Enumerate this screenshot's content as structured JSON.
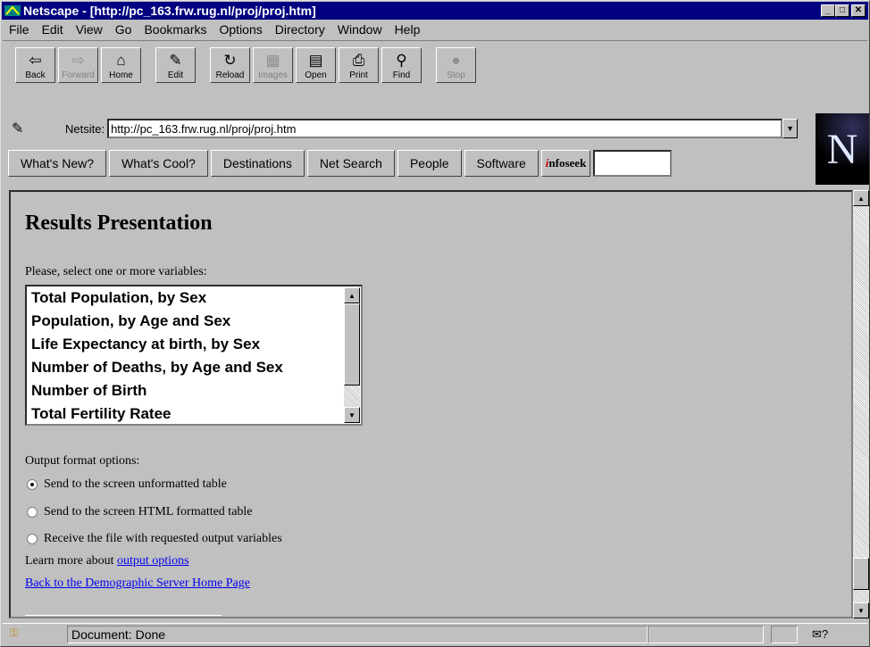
{
  "window": {
    "title": "Netscape - [http://pc_163.frw.rug.nl/proj/proj.htm]"
  },
  "menu": [
    "File",
    "Edit",
    "View",
    "Go",
    "Bookmarks",
    "Options",
    "Directory",
    "Window",
    "Help"
  ],
  "toolbar": {
    "back": "Back",
    "forward": "Forward",
    "home": "Home",
    "edit": "Edit",
    "reload": "Reload",
    "images": "Images",
    "open": "Open",
    "print": "Print",
    "find": "Find",
    "stop": "Stop"
  },
  "location": {
    "label": "Netsite:",
    "url": "http://pc_163.frw.rug.nl/proj/proj.htm"
  },
  "directory": [
    "What's New?",
    "What's Cool?",
    "Destinations",
    "Net Search",
    "People",
    "Software"
  ],
  "infoseek": {
    "i": "i",
    "rest": "nfoseek"
  },
  "logo": "N",
  "page": {
    "heading": "Results Presentation",
    "prompt": "Please, select one or more variables:",
    "variables": [
      "Total Population, by Sex",
      "Population, by Age and Sex",
      "Life Expectancy at birth, by Sex",
      "Number of Deaths, by Age and Sex",
      "Number of Birth",
      "Total Fertility Ratee"
    ],
    "output_label": "Output format options:",
    "options": [
      "Send to the screen unformatted table",
      "Send to the screen HTML formatted table",
      "Receive the file with requested output variables"
    ],
    "learn_text": "Learn more about ",
    "learn_link": "output options ",
    "back_link": "Back to the Demographic Server Home Page"
  },
  "status": {
    "message": "Document: Done"
  }
}
